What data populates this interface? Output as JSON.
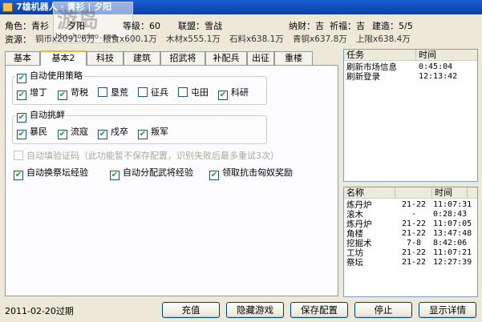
{
  "window": {
    "title": "7雄机器人 · 青衫 | 夕阳"
  },
  "watermark": {
    "logo": "游岛",
    "url": "bbs.houdao.com"
  },
  "info": {
    "role": "角色：青衫",
    "role_name": "夕阳",
    "level": "等级：60",
    "alliance": "联盟：雪战",
    "naming": "纳财：吉",
    "blessing": "祈福：吉",
    "build": "建造：5/5"
  },
  "resources": {
    "label": "资源：",
    "copper": "铜币x2091.6万",
    "food": "粮食x600.1万",
    "wood": "木材x555.1万",
    "stone": "石料x638.1万",
    "bronze": "青铜x637.8万",
    "cap": "上限x638.4万"
  },
  "tabs": [
    "基本",
    "基本2",
    "科技",
    "建筑",
    "招武将",
    "补配兵",
    "出征",
    "重楼"
  ],
  "strategy_group": {
    "legend": "自动使用策略",
    "legend_checked": true,
    "items": [
      {
        "label": "增丁",
        "checked": true
      },
      {
        "label": "苛税",
        "checked": true
      },
      {
        "label": "垦荒",
        "checked": false
      },
      {
        "label": "征兵",
        "checked": false
      },
      {
        "label": "屯田",
        "checked": false
      },
      {
        "label": "科研",
        "checked": true
      }
    ]
  },
  "raid_group": {
    "legend": "自动挑衅",
    "legend_checked": true,
    "items": [
      {
        "label": "暴民",
        "checked": true
      },
      {
        "label": "流寇",
        "checked": true
      },
      {
        "label": "戍卒",
        "checked": true
      },
      {
        "label": "叛军",
        "checked": true
      }
    ]
  },
  "captcha_option": {
    "label": "自动填验证码（此功能暂不保存配置，识别失败后最多重试3次）",
    "checked": false
  },
  "options": [
    {
      "label": "自动换祭坛经验",
      "checked": true
    },
    {
      "label": "自动分配武将经验",
      "checked": true
    },
    {
      "label": "领取抗击匈奴奖励",
      "checked": true
    }
  ],
  "task_table": {
    "headers": [
      "任务",
      "时间"
    ],
    "rows": [
      [
        "刷新市场信息",
        "0:45:04"
      ],
      [
        "刷新登录",
        "12:13:42"
      ]
    ]
  },
  "building_table": {
    "headers": [
      "名称",
      "",
      "时间"
    ],
    "rows": [
      [
        "炼丹炉",
        "21-22",
        "11:07:31"
      ],
      [
        "滚木",
        "-",
        "0:28:43"
      ],
      [
        "炼丹炉",
        "21-22",
        "11:07:05"
      ],
      [
        "角楼",
        "21-22",
        "13:47:48"
      ],
      [
        "挖掘术",
        "7-8",
        "8:42:06"
      ],
      [
        "工坊",
        "21-22",
        "11:07:21"
      ],
      [
        "祭坛",
        "21-22",
        "12:27:39"
      ]
    ]
  },
  "buttons": {
    "recharge": "充值",
    "hide_game": "隐藏游戏",
    "save_config": "保存配置",
    "stop": "停止",
    "show_details": "显示详情"
  },
  "status": {
    "expiry": "2011-02-20过期"
  },
  "colors": {
    "accent": "#f9b232",
    "check": "#21a121",
    "titlebar": "#0a3fa8"
  }
}
